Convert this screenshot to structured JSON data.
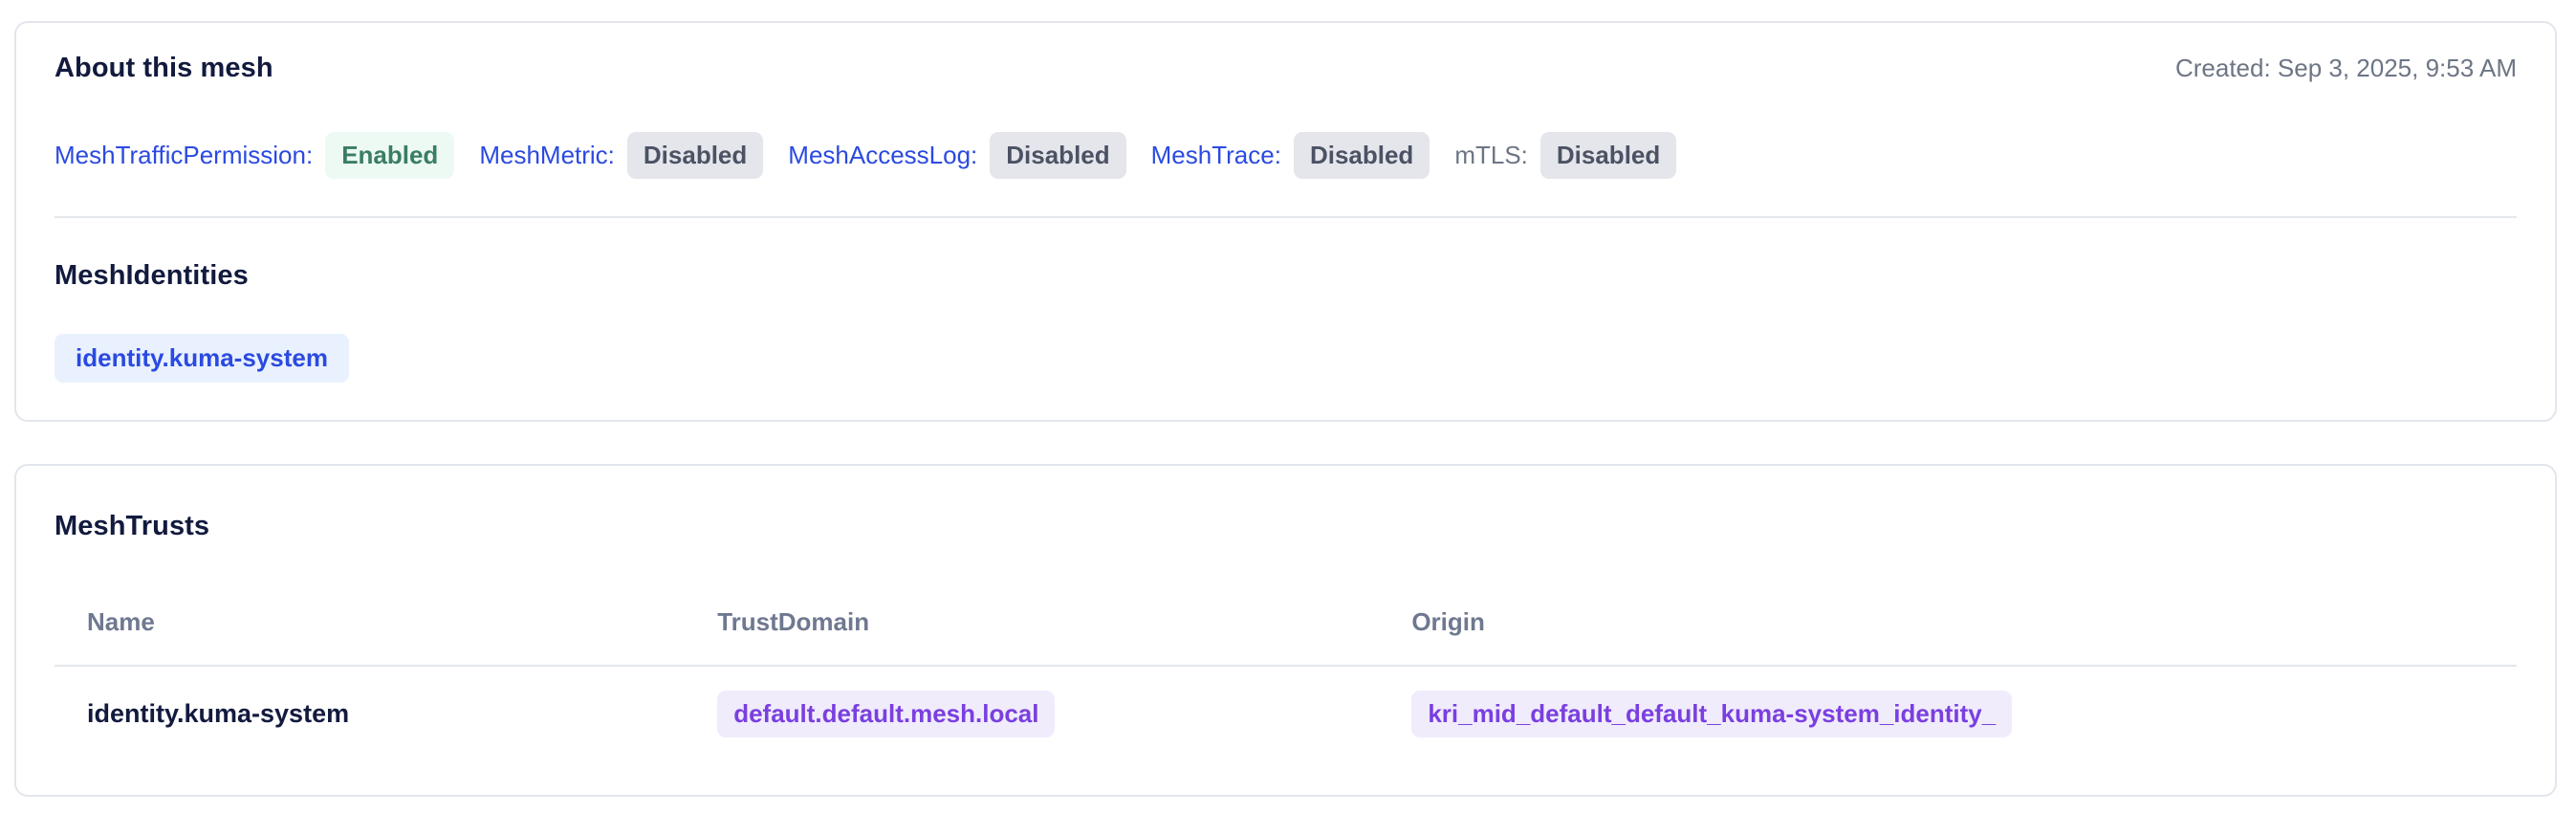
{
  "about_card": {
    "title": "About this mesh",
    "created": "Created: Sep 3, 2025, 9:53 AM",
    "policies": [
      {
        "label": "MeshTrafficPermission:",
        "status": "Enabled",
        "is_link": true
      },
      {
        "label": "MeshMetric:",
        "status": "Disabled",
        "is_link": true
      },
      {
        "label": "MeshAccessLog:",
        "status": "Disabled",
        "is_link": true
      },
      {
        "label": "MeshTrace:",
        "status": "Disabled",
        "is_link": true
      },
      {
        "label": "mTLS:",
        "status": "Disabled",
        "is_link": false
      }
    ],
    "identities": {
      "title": "MeshIdentities",
      "items": [
        "identity.kuma-system"
      ]
    }
  },
  "trusts_card": {
    "title": "MeshTrusts",
    "table": {
      "headers": [
        "Name",
        "TrustDomain",
        "Origin"
      ],
      "rows": [
        {
          "name": "identity.kuma-system",
          "trust_domain": "default.default.mesh.local",
          "origin": "kri_mid_default_default_kuma-system_identity_"
        }
      ]
    }
  },
  "colors": {
    "heading_navy": "#121a3e",
    "link_blue": "#2b4ae0",
    "muted_gray": "#6d7585",
    "table_header_gray": "#6f7890",
    "success_text": "#3a7d64",
    "success_bg": "#edfaf4",
    "neutral_text": "#4c5264",
    "neutral_bg": "#e4e6eb",
    "info_text": "#2b4ae0",
    "info_bg": "#e9f1fe",
    "purple_text": "#7a3fe0",
    "purple_bg": "#f0ecfc",
    "card_border": "#e2e6ec"
  }
}
